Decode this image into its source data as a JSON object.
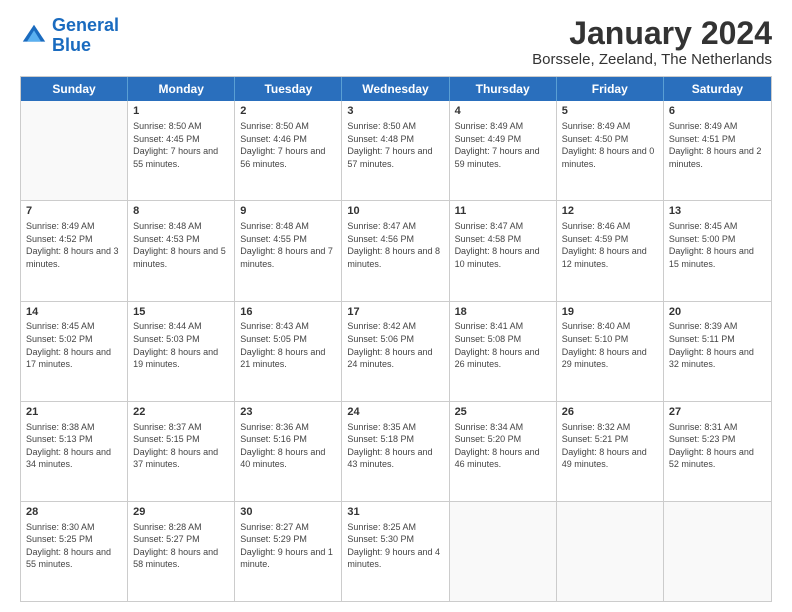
{
  "logo": {
    "line1": "General",
    "line2": "Blue"
  },
  "calendar": {
    "title": "January 2024",
    "subtitle": "Borssele, Zeeland, The Netherlands",
    "headers": [
      "Sunday",
      "Monday",
      "Tuesday",
      "Wednesday",
      "Thursday",
      "Friday",
      "Saturday"
    ],
    "rows": [
      [
        {
          "date": "",
          "sunrise": "",
          "sunset": "",
          "daylight": "",
          "empty": true
        },
        {
          "date": "1",
          "sunrise": "Sunrise: 8:50 AM",
          "sunset": "Sunset: 4:45 PM",
          "daylight": "Daylight: 7 hours and 55 minutes."
        },
        {
          "date": "2",
          "sunrise": "Sunrise: 8:50 AM",
          "sunset": "Sunset: 4:46 PM",
          "daylight": "Daylight: 7 hours and 56 minutes."
        },
        {
          "date": "3",
          "sunrise": "Sunrise: 8:50 AM",
          "sunset": "Sunset: 4:48 PM",
          "daylight": "Daylight: 7 hours and 57 minutes."
        },
        {
          "date": "4",
          "sunrise": "Sunrise: 8:49 AM",
          "sunset": "Sunset: 4:49 PM",
          "daylight": "Daylight: 7 hours and 59 minutes."
        },
        {
          "date": "5",
          "sunrise": "Sunrise: 8:49 AM",
          "sunset": "Sunset: 4:50 PM",
          "daylight": "Daylight: 8 hours and 0 minutes."
        },
        {
          "date": "6",
          "sunrise": "Sunrise: 8:49 AM",
          "sunset": "Sunset: 4:51 PM",
          "daylight": "Daylight: 8 hours and 2 minutes."
        }
      ],
      [
        {
          "date": "7",
          "sunrise": "Sunrise: 8:49 AM",
          "sunset": "Sunset: 4:52 PM",
          "daylight": "Daylight: 8 hours and 3 minutes."
        },
        {
          "date": "8",
          "sunrise": "Sunrise: 8:48 AM",
          "sunset": "Sunset: 4:53 PM",
          "daylight": "Daylight: 8 hours and 5 minutes."
        },
        {
          "date": "9",
          "sunrise": "Sunrise: 8:48 AM",
          "sunset": "Sunset: 4:55 PM",
          "daylight": "Daylight: 8 hours and 7 minutes."
        },
        {
          "date": "10",
          "sunrise": "Sunrise: 8:47 AM",
          "sunset": "Sunset: 4:56 PM",
          "daylight": "Daylight: 8 hours and 8 minutes."
        },
        {
          "date": "11",
          "sunrise": "Sunrise: 8:47 AM",
          "sunset": "Sunset: 4:58 PM",
          "daylight": "Daylight: 8 hours and 10 minutes."
        },
        {
          "date": "12",
          "sunrise": "Sunrise: 8:46 AM",
          "sunset": "Sunset: 4:59 PM",
          "daylight": "Daylight: 8 hours and 12 minutes."
        },
        {
          "date": "13",
          "sunrise": "Sunrise: 8:45 AM",
          "sunset": "Sunset: 5:00 PM",
          "daylight": "Daylight: 8 hours and 15 minutes."
        }
      ],
      [
        {
          "date": "14",
          "sunrise": "Sunrise: 8:45 AM",
          "sunset": "Sunset: 5:02 PM",
          "daylight": "Daylight: 8 hours and 17 minutes."
        },
        {
          "date": "15",
          "sunrise": "Sunrise: 8:44 AM",
          "sunset": "Sunset: 5:03 PM",
          "daylight": "Daylight: 8 hours and 19 minutes."
        },
        {
          "date": "16",
          "sunrise": "Sunrise: 8:43 AM",
          "sunset": "Sunset: 5:05 PM",
          "daylight": "Daylight: 8 hours and 21 minutes."
        },
        {
          "date": "17",
          "sunrise": "Sunrise: 8:42 AM",
          "sunset": "Sunset: 5:06 PM",
          "daylight": "Daylight: 8 hours and 24 minutes."
        },
        {
          "date": "18",
          "sunrise": "Sunrise: 8:41 AM",
          "sunset": "Sunset: 5:08 PM",
          "daylight": "Daylight: 8 hours and 26 minutes."
        },
        {
          "date": "19",
          "sunrise": "Sunrise: 8:40 AM",
          "sunset": "Sunset: 5:10 PM",
          "daylight": "Daylight: 8 hours and 29 minutes."
        },
        {
          "date": "20",
          "sunrise": "Sunrise: 8:39 AM",
          "sunset": "Sunset: 5:11 PM",
          "daylight": "Daylight: 8 hours and 32 minutes."
        }
      ],
      [
        {
          "date": "21",
          "sunrise": "Sunrise: 8:38 AM",
          "sunset": "Sunset: 5:13 PM",
          "daylight": "Daylight: 8 hours and 34 minutes."
        },
        {
          "date": "22",
          "sunrise": "Sunrise: 8:37 AM",
          "sunset": "Sunset: 5:15 PM",
          "daylight": "Daylight: 8 hours and 37 minutes."
        },
        {
          "date": "23",
          "sunrise": "Sunrise: 8:36 AM",
          "sunset": "Sunset: 5:16 PM",
          "daylight": "Daylight: 8 hours and 40 minutes."
        },
        {
          "date": "24",
          "sunrise": "Sunrise: 8:35 AM",
          "sunset": "Sunset: 5:18 PM",
          "daylight": "Daylight: 8 hours and 43 minutes."
        },
        {
          "date": "25",
          "sunrise": "Sunrise: 8:34 AM",
          "sunset": "Sunset: 5:20 PM",
          "daylight": "Daylight: 8 hours and 46 minutes."
        },
        {
          "date": "26",
          "sunrise": "Sunrise: 8:32 AM",
          "sunset": "Sunset: 5:21 PM",
          "daylight": "Daylight: 8 hours and 49 minutes."
        },
        {
          "date": "27",
          "sunrise": "Sunrise: 8:31 AM",
          "sunset": "Sunset: 5:23 PM",
          "daylight": "Daylight: 8 hours and 52 minutes."
        }
      ],
      [
        {
          "date": "28",
          "sunrise": "Sunrise: 8:30 AM",
          "sunset": "Sunset: 5:25 PM",
          "daylight": "Daylight: 8 hours and 55 minutes."
        },
        {
          "date": "29",
          "sunrise": "Sunrise: 8:28 AM",
          "sunset": "Sunset: 5:27 PM",
          "daylight": "Daylight: 8 hours and 58 minutes."
        },
        {
          "date": "30",
          "sunrise": "Sunrise: 8:27 AM",
          "sunset": "Sunset: 5:29 PM",
          "daylight": "Daylight: 9 hours and 1 minute."
        },
        {
          "date": "31",
          "sunrise": "Sunrise: 8:25 AM",
          "sunset": "Sunset: 5:30 PM",
          "daylight": "Daylight: 9 hours and 4 minutes."
        },
        {
          "date": "",
          "sunrise": "",
          "sunset": "",
          "daylight": "",
          "empty": true
        },
        {
          "date": "",
          "sunrise": "",
          "sunset": "",
          "daylight": "",
          "empty": true
        },
        {
          "date": "",
          "sunrise": "",
          "sunset": "",
          "daylight": "",
          "empty": true
        }
      ]
    ]
  }
}
